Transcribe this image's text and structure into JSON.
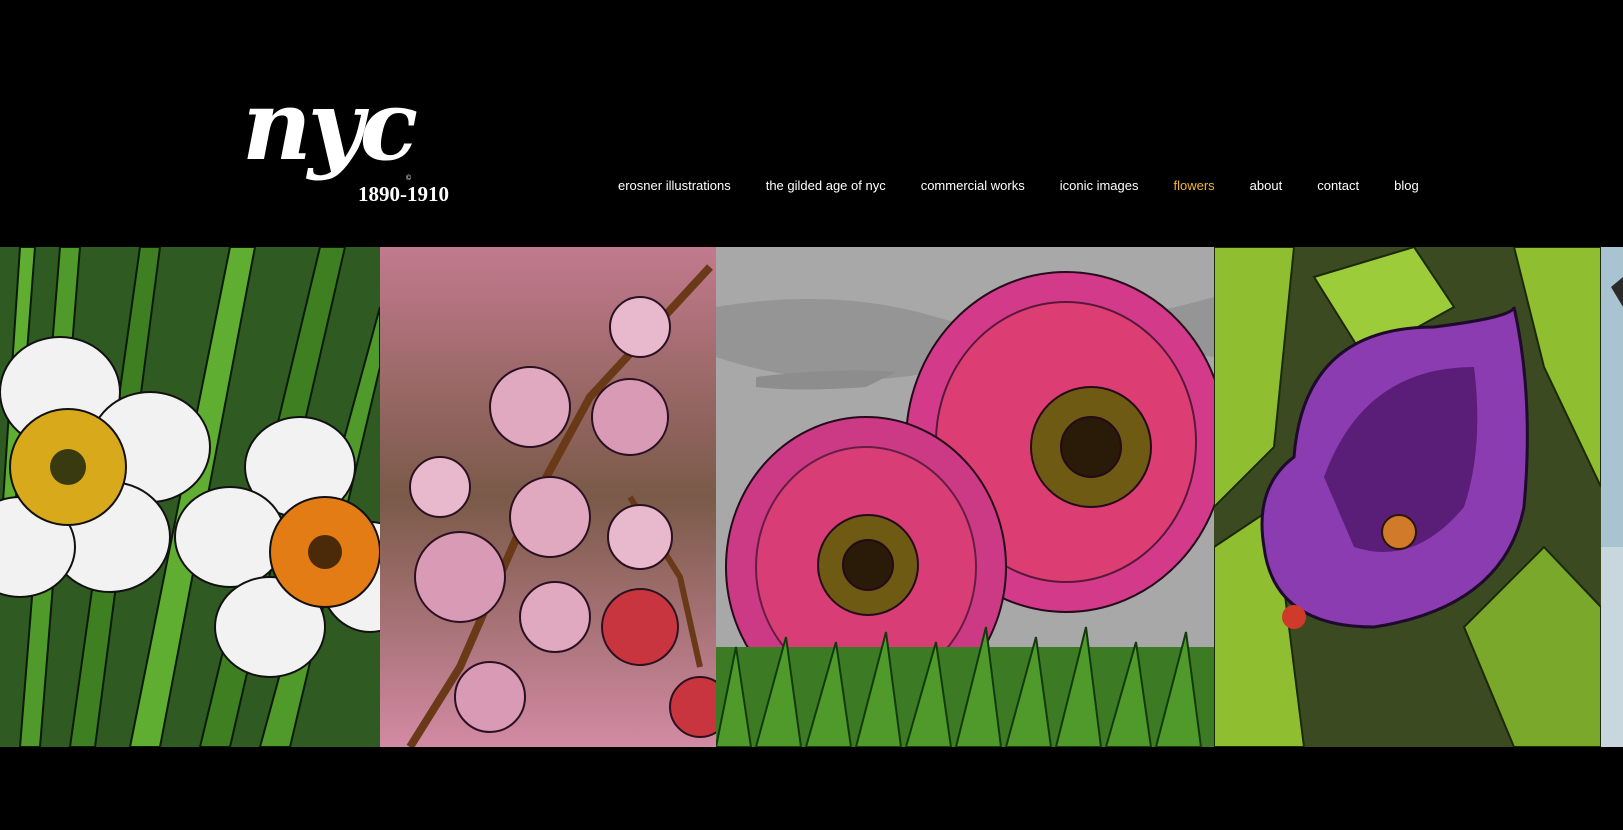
{
  "logo": {
    "main": "nyc",
    "years": "1890-1910",
    "mark": "©"
  },
  "nav": {
    "items": [
      {
        "label": "erosner illustrations"
      },
      {
        "label": "the gilded age of nyc"
      },
      {
        "label": "commercial works"
      },
      {
        "label": "iconic images"
      },
      {
        "label": "flowers",
        "active": true
      },
      {
        "label": "about"
      },
      {
        "label": "contact"
      },
      {
        "label": "blog"
      }
    ],
    "active_color": "#f2b630"
  },
  "gallery": {
    "images": [
      {
        "subject": "daffodils"
      },
      {
        "subject": "cherry-blossoms"
      },
      {
        "subject": "gerbera-daisies"
      },
      {
        "subject": "calla-lily"
      },
      {
        "subject": "partial-image"
      }
    ]
  }
}
